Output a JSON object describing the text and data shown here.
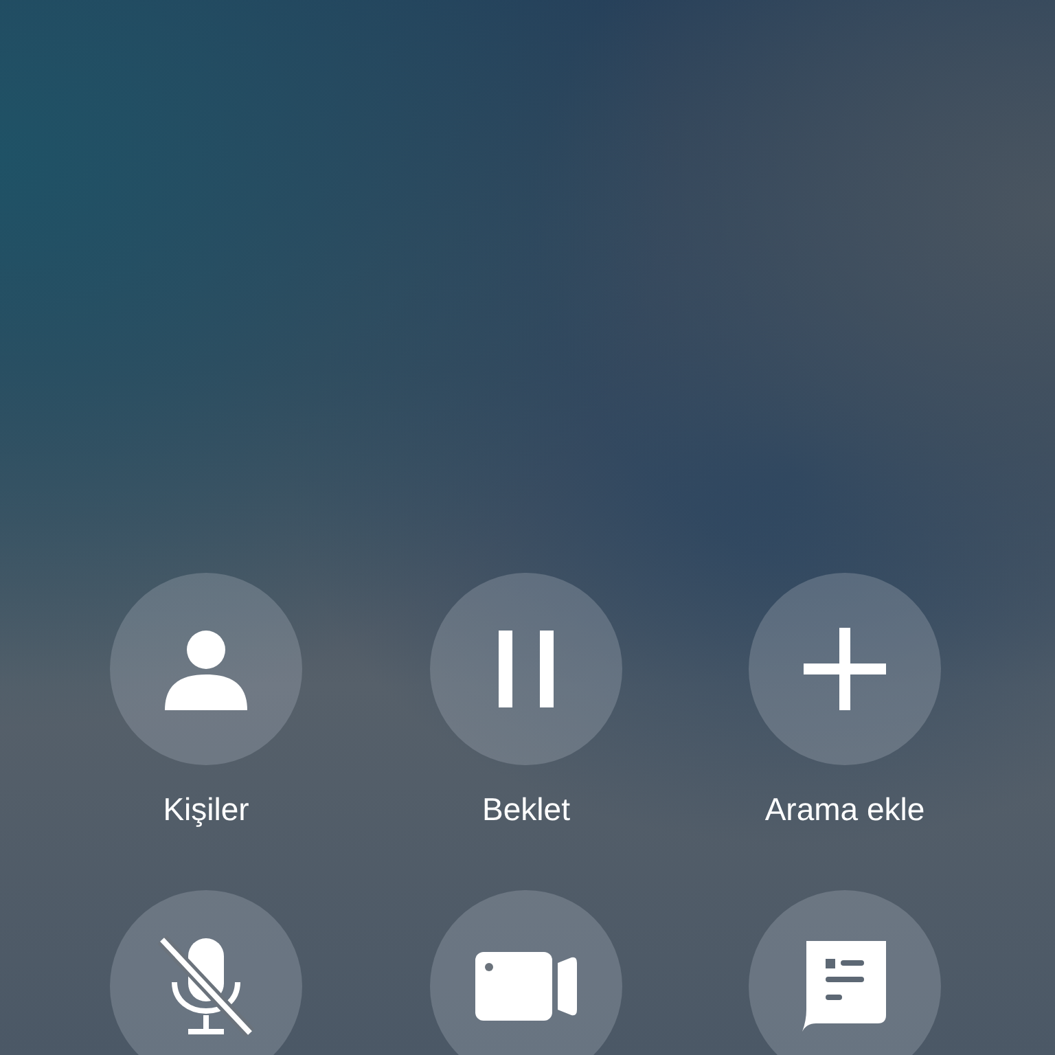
{
  "buttons": [
    {
      "kind": "contacts",
      "label": "Kişiler"
    },
    {
      "kind": "hold",
      "label": "Beklet"
    },
    {
      "kind": "add",
      "label": "Arama ekle"
    },
    {
      "kind": "mute"
    },
    {
      "kind": "video"
    },
    {
      "kind": "notes"
    }
  ]
}
